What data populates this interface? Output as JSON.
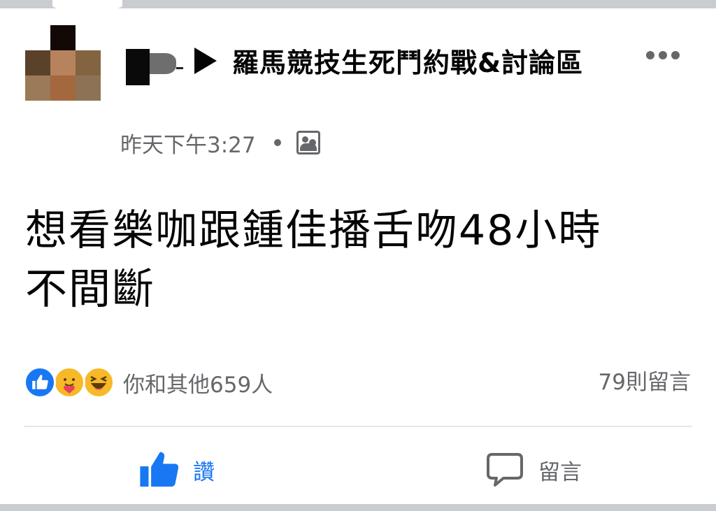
{
  "post": {
    "group_name": "羅馬競技生死鬥約戰&討論區",
    "timestamp": "昨天下午3:27",
    "privacy_icon": "group-icon",
    "text_line1": "想看樂咖跟鍾佳播舌吻48小時",
    "text_line2": "不間斷"
  },
  "reactions": {
    "icons": [
      "like",
      "care",
      "haha"
    ],
    "summary": "你和其他659人",
    "comments": "79則留言"
  },
  "actions": {
    "like_label": "讚",
    "comment_label": "留言"
  },
  "colors": {
    "accent": "#1877f2",
    "secondary_text": "#65676b",
    "reaction_yellow": "#f7b928"
  }
}
